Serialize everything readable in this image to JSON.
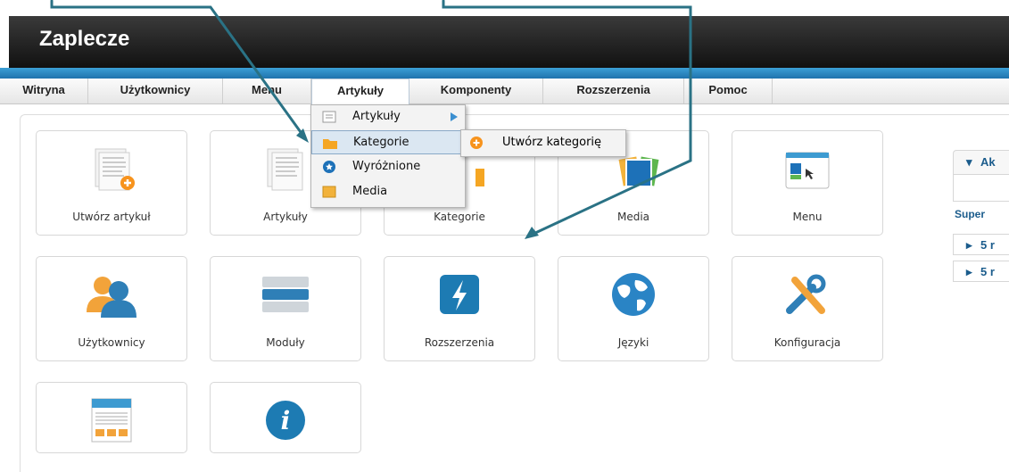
{
  "header": {
    "title": "Zaplecze"
  },
  "menubar": [
    {
      "label": "Witryna"
    },
    {
      "label": "Użytkownicy"
    },
    {
      "label": "Menu"
    },
    {
      "label": "Artykuły"
    },
    {
      "label": "Komponenty"
    },
    {
      "label": "Rozszerzenia"
    },
    {
      "label": "Pomoc"
    }
  ],
  "dropdown": [
    {
      "label": "Artykuły",
      "icon": "document-icon"
    },
    {
      "label": "Kategorie",
      "icon": "folder-icon"
    },
    {
      "label": "Wyróżnione",
      "icon": "star-icon"
    },
    {
      "label": "Media",
      "icon": "image-icon"
    }
  ],
  "submenu": {
    "label": "Utwórz kategorię"
  },
  "tiles": [
    {
      "label": "Utwórz artykuł"
    },
    {
      "label": "Artykuły"
    },
    {
      "label": "Kategorie"
    },
    {
      "label": "Media"
    },
    {
      "label": "Menu"
    },
    {
      "label": "Użytkownicy"
    },
    {
      "label": "Moduły"
    },
    {
      "label": "Rozszerzenia"
    },
    {
      "label": "Języki"
    },
    {
      "label": "Konfiguracja"
    },
    {
      "label": ""
    },
    {
      "label": ""
    }
  ],
  "right_panel": {
    "head": "Ak",
    "user": "Super",
    "rows": [
      "5 r",
      "5 r"
    ]
  },
  "colors": {
    "accent": "#1f73ad",
    "arrow": "#2a7285"
  }
}
